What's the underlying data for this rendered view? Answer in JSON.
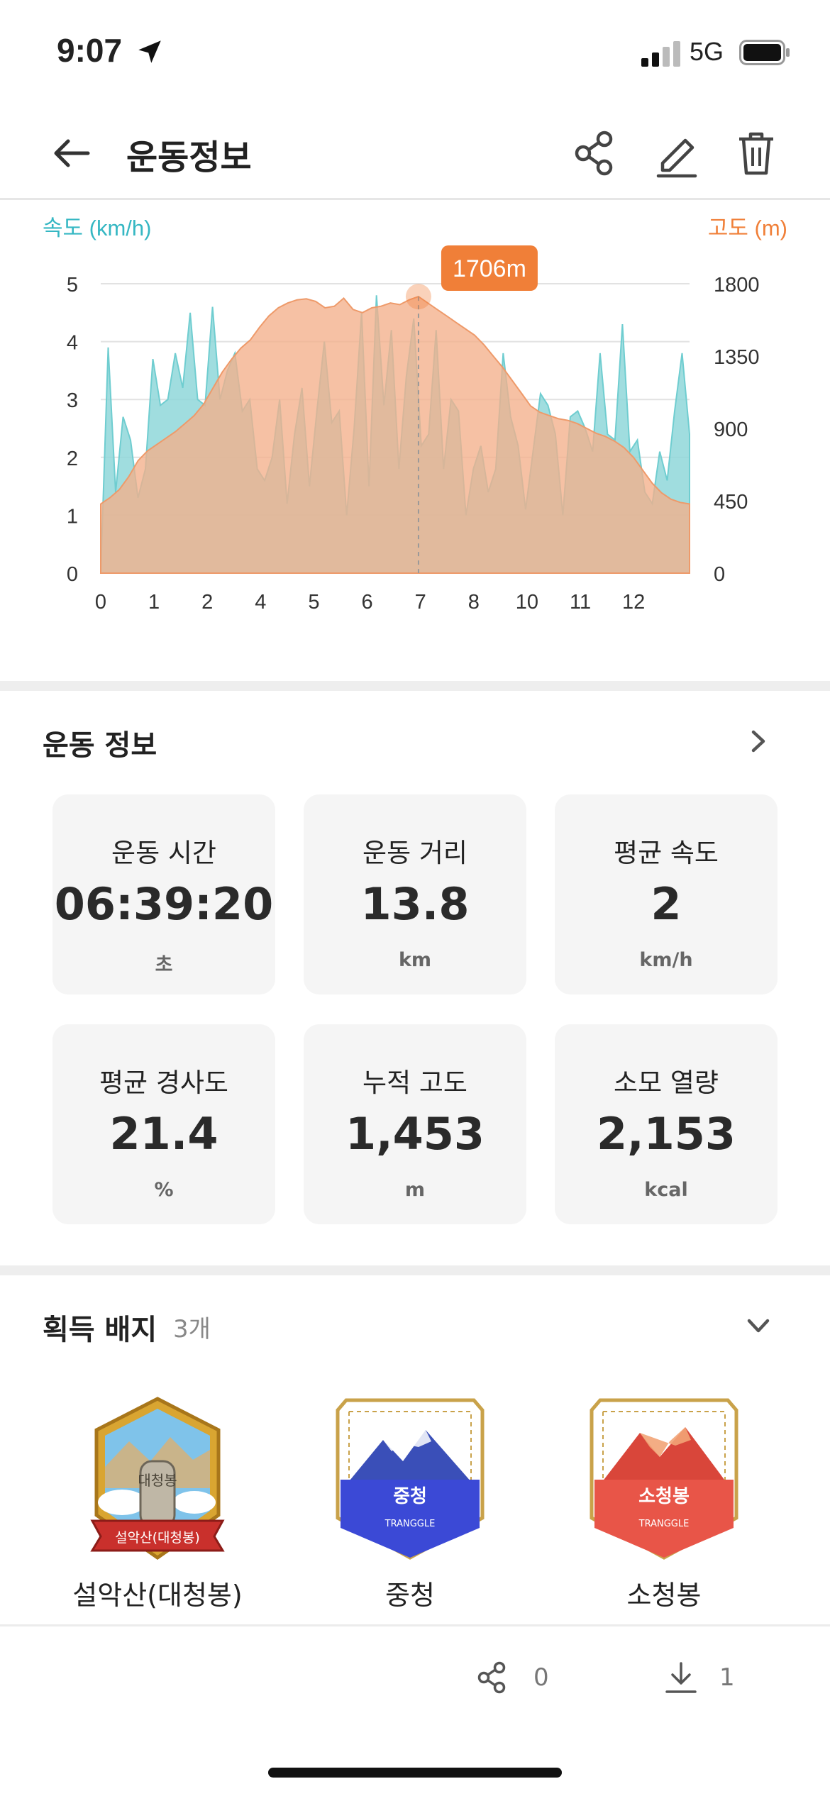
{
  "status_bar": {
    "time": "9:07",
    "network": "5G"
  },
  "header": {
    "title": "운동정보",
    "icons": [
      "back-arrow-icon",
      "share-icon",
      "edit-icon",
      "trash-icon"
    ]
  },
  "chart_data": {
    "type": "area",
    "left_axis_label": "속도 (km/h)",
    "right_axis_label": "고도 (m)",
    "left_ticks": [
      "5",
      "4",
      "3",
      "2",
      "1",
      "0"
    ],
    "right_ticks": [
      "1800",
      "1350",
      "900",
      "450",
      "0"
    ],
    "x_ticks": [
      "0",
      "1",
      "2",
      "4",
      "5",
      "6",
      "7",
      "8",
      "10",
      "11",
      "12"
    ],
    "tooltip": "1706m",
    "colors": {
      "speed": "#8fd7d9",
      "altitude": "#f4b08a",
      "accent": "#f07f38",
      "speed_label": "#35b7c3"
    },
    "series": [
      {
        "name": "속도 (km/h)",
        "axis": "left",
        "values": [
          0,
          3.9,
          1.4,
          2.7,
          2.3,
          1.3,
          1.8,
          3.7,
          2.9,
          3.0,
          3.8,
          3.2,
          4.5,
          3.0,
          2.9,
          4.6,
          3.0,
          3.5,
          3.8,
          2.8,
          3.0,
          1.8,
          1.6,
          2.0,
          3.0,
          1.2,
          2.4,
          3.2,
          1.5,
          2.8,
          4.0,
          2.6,
          2.8,
          1.0,
          2.5,
          4.5,
          1.5,
          4.8,
          2.9,
          4.2,
          1.8,
          3.4,
          4.4,
          2.2,
          2.4,
          4.2,
          1.8,
          3.0,
          2.8,
          1.0,
          1.8,
          2.2,
          1.4,
          1.8,
          3.8,
          2.7,
          2.2,
          1.1,
          2.1,
          3.1,
          2.9,
          2.4,
          1.0,
          2.7,
          2.8,
          2.5,
          2.1,
          3.8,
          2.4,
          2.3,
          4.3,
          2.1,
          2.3,
          1.4,
          1.2,
          2.1,
          1.6,
          2.8,
          3.8,
          2.4
        ]
      },
      {
        "name": "고도 (m)",
        "axis": "right",
        "values": [
          430,
          470,
          520,
          600,
          700,
          760,
          800,
          840,
          880,
          930,
          980,
          1050,
          1150,
          1250,
          1330,
          1400,
          1450,
          1530,
          1600,
          1650,
          1680,
          1700,
          1706,
          1690,
          1650,
          1660,
          1710,
          1640,
          1620,
          1650,
          1660,
          1680,
          1670,
          1700,
          1720,
          1680,
          1640,
          1600,
          1560,
          1520,
          1480,
          1420,
          1350,
          1280,
          1200,
          1120,
          1040,
          1000,
          980,
          960,
          950,
          930,
          900,
          870,
          850,
          820,
          780,
          720,
          640,
          560,
          500,
          460,
          440,
          430
        ]
      }
    ]
  },
  "info": {
    "title": "운동 정보",
    "cards": [
      {
        "label": "운동 시간",
        "value": "06:39:20",
        "unit": "초"
      },
      {
        "label": "운동 거리",
        "value": "13.8",
        "unit": "km"
      },
      {
        "label": "평균 속도",
        "value": "2",
        "unit": "km/h"
      },
      {
        "label": "평균 경사도",
        "value": "21.4",
        "unit": "%"
      },
      {
        "label": "누적 고도",
        "value": "1,453",
        "unit": "m"
      },
      {
        "label": "소모 열량",
        "value": "2,153",
        "unit": "kcal"
      }
    ]
  },
  "badges": {
    "title": "획득 배지",
    "count": "3개",
    "items": [
      {
        "name": "설악산(대청봉)",
        "emblem_text": "대청봉",
        "ribbon_text": "설악산(대청봉)"
      },
      {
        "name": "중청",
        "emblem_text": "중청",
        "sub_text": "TRANGGLE"
      },
      {
        "name": "소청봉",
        "emblem_text": "소청봉",
        "sub_text": "TRANGGLE"
      }
    ]
  },
  "bottom_bar": {
    "share_count": "0",
    "download_count": "1"
  }
}
